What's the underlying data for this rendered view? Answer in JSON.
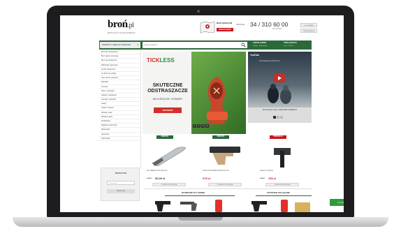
{
  "header": {
    "logo_main": "broń",
    "logo_suffix": ".pl",
    "tagline": "BROŃ PALNA I KOLEKCJONERSKA",
    "map_text": "MAPA ODZIAŁÓW",
    "map_button": "ZOBACZ MAPĘ",
    "phone_label": "INFOLINIA",
    "phone": "34 / 310 60 00",
    "phone_alt": "601 430 902",
    "btn_login": "LOGOWANIE",
    "btn_register": "REJESTRACJA"
  },
  "nav": {
    "products_label": "PRODUKTY WEDŁUG KATEGORII",
    "search_placeholder": "Czego szukasz?",
    "account_title": "TWOJE KONTO",
    "account_sub": "Zaloguj · Rejestracja",
    "cart_title": "TWÓJ KOSZYK",
    "cart_sub": "0 szt. · 0,00 zł"
  },
  "sidebar": {
    "categories": [
      "Broń bez pozwolenia",
      "Broń palna i amunicja",
      "Broń pneumatyczna",
      "Wiatrówki i akcesoria",
      "Łuczki i akcesoria",
      "Air Soft Gun (ASG)",
      "Łuki i kusze sportowe",
      "Paintball",
      "Survival",
      "Noże i narzędzia",
      "Latarki i oświetlenie",
      "Lornetki i celowniki",
      "Lasery",
      "Odzież i obuwie",
      "Plecaki i torby",
      "Miotacze gazu",
      "Paralizatory",
      "Kajdanki i akcesoria",
      "Elektronika",
      "Akcesoria",
      "Wyprzedaż"
    ],
    "widget_title": "NEWSLETTER",
    "widget_input": "Twój e-mail",
    "widget_button": "ZAPISZ SIĘ"
  },
  "banner": {
    "brand_part1": "TICK",
    "brand_part2": "LESS",
    "headline": "SKUTECZNE ODSTRASZACZE",
    "subline": "NA KLESZCZE I KOMARY",
    "cta": "SPRAWDŹ",
    "dots": [
      "1",
      "2",
      "3",
      "4"
    ]
  },
  "video": {
    "logo": "YouTube",
    "title": "Prezentacja kombinezonu",
    "caption": "Prezentacja w akcji: TARGOWE KAMIZELKI",
    "accent": "#c4302b"
  },
  "products": [
    {
      "badge": "NOWOŚĆ",
      "badge_color": "#2a6a3a",
      "name": "Nóż składany Puma Survival",
      "price_old": "149 zł",
      "price": "90,00 zł",
      "button": "DODAJ DO KOSZYKA"
    },
    {
      "badge": "NOWOŚĆ",
      "badge_color": "#2a6a3a",
      "name": "Pistolet ASG Walther P99 Desert Tan",
      "price_old": "",
      "price": "379 zł",
      "button": "DODAJ DO KOSZYKA"
    },
    {
      "badge": "PROMOCJA",
      "badge_color": "#c8161d",
      "name": "Siekiera z pochwą",
      "price_old": "229 zł",
      "price": "199 zł",
      "button": "DODAJ DO KOSZYKA"
    }
  ],
  "bottom": {
    "tab1": "WYBRANE DLA CIEBIE",
    "tab2": "OSTATNIO OGLĄDANE"
  },
  "chat": {
    "label": "Porozmawiaj z nami"
  },
  "colors": {
    "brand_green": "#2a6a3a",
    "brand_red": "#c8161d"
  }
}
